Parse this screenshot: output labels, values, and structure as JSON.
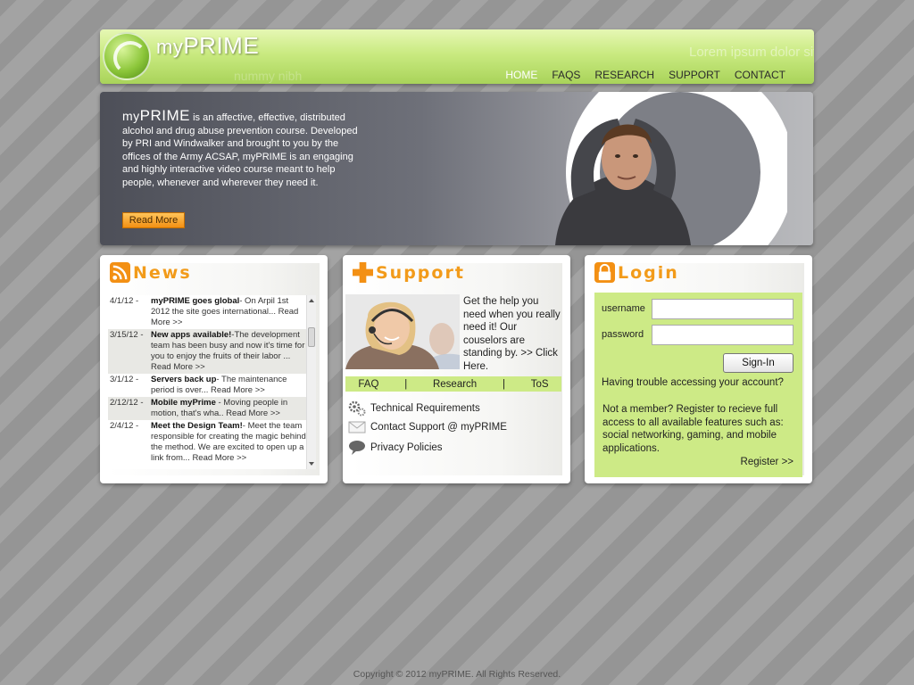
{
  "header": {
    "logo_prefix": "my",
    "logo_main": "PRIME",
    "watermark_1": "Lorem ipsum dolor sit amet",
    "watermark_2": "nummy nibh",
    "nav": [
      {
        "label": "HOME",
        "active": true
      },
      {
        "label": "FAQS",
        "active": false
      },
      {
        "label": "RESEARCH",
        "active": false
      },
      {
        "label": "SUPPORT",
        "active": false
      },
      {
        "label": "CONTACT",
        "active": false
      }
    ]
  },
  "banner": {
    "brand_prefix": "my",
    "brand_main": "PRIME",
    "description": " is an affective, effective, distributed alcohol and drug abuse prevention course. Developed by PRI and Windwalker and brought to you by the offices of the Army ACSAP, myPRIME is an engaging and highly interactive video course meant to help people, whenever and wherever they need it.",
    "read_more": "Read More"
  },
  "news": {
    "title": "News",
    "items": [
      {
        "date": "4/1/12 -",
        "headline": "myPRIME goes global",
        "text": "- On Arpil 1st 2012 the site goes international... Read More >>"
      },
      {
        "date": "3/15/12 -",
        "headline": "New apps available!",
        "text": "-The development team has been busy and now it's time for you to enjoy the fruits of their labor ... Read More >>"
      },
      {
        "date": "3/1/12 -",
        "headline": "Servers back up",
        "text": "- The maintenance period is over... Read More >>"
      },
      {
        "date": "2/12/12 -",
        "headline": "Mobile myPrime",
        "text": " - Moving people in motion, that's wha.. Read More >>"
      },
      {
        "date": "2/4/12 -",
        "headline": "Meet the Design Team!",
        "text": "- Meet the team responsible for creating the magic behind the method. We are excited to open up a link from... Read More >>"
      }
    ]
  },
  "support": {
    "title": "Support",
    "help_text": "Get the help you need when you really need it! Our couselors are standing by.",
    "click_here": ">> Click Here.",
    "links": [
      "FAQ",
      "|",
      "Research",
      "|",
      "ToS"
    ],
    "items": [
      {
        "label": "Technical Requirements",
        "icon": "gears-icon"
      },
      {
        "label": "Contact Support @ myPRIME",
        "icon": "envelope-icon"
      },
      {
        "label": "Privacy Policies",
        "icon": "speech-bubble-icon"
      }
    ]
  },
  "login": {
    "title": "Login",
    "username_label": "username",
    "password_label": "password",
    "username_value": "",
    "password_value": "",
    "signin_label": "Sign-In",
    "trouble_text": "Having trouble accessing your account?",
    "member_text": "Not a member? Register  to recieve full access to all available features such as: social networking, gaming, and mobile applications.",
    "register_label": "Register >>"
  },
  "footer": {
    "copyright": "Copyright © 2012 myPRIME. All Rights Reserved."
  },
  "colors": {
    "accent_green": "#cdea86",
    "title_orange": "#f29b1a",
    "button_orange": "#f39014"
  }
}
